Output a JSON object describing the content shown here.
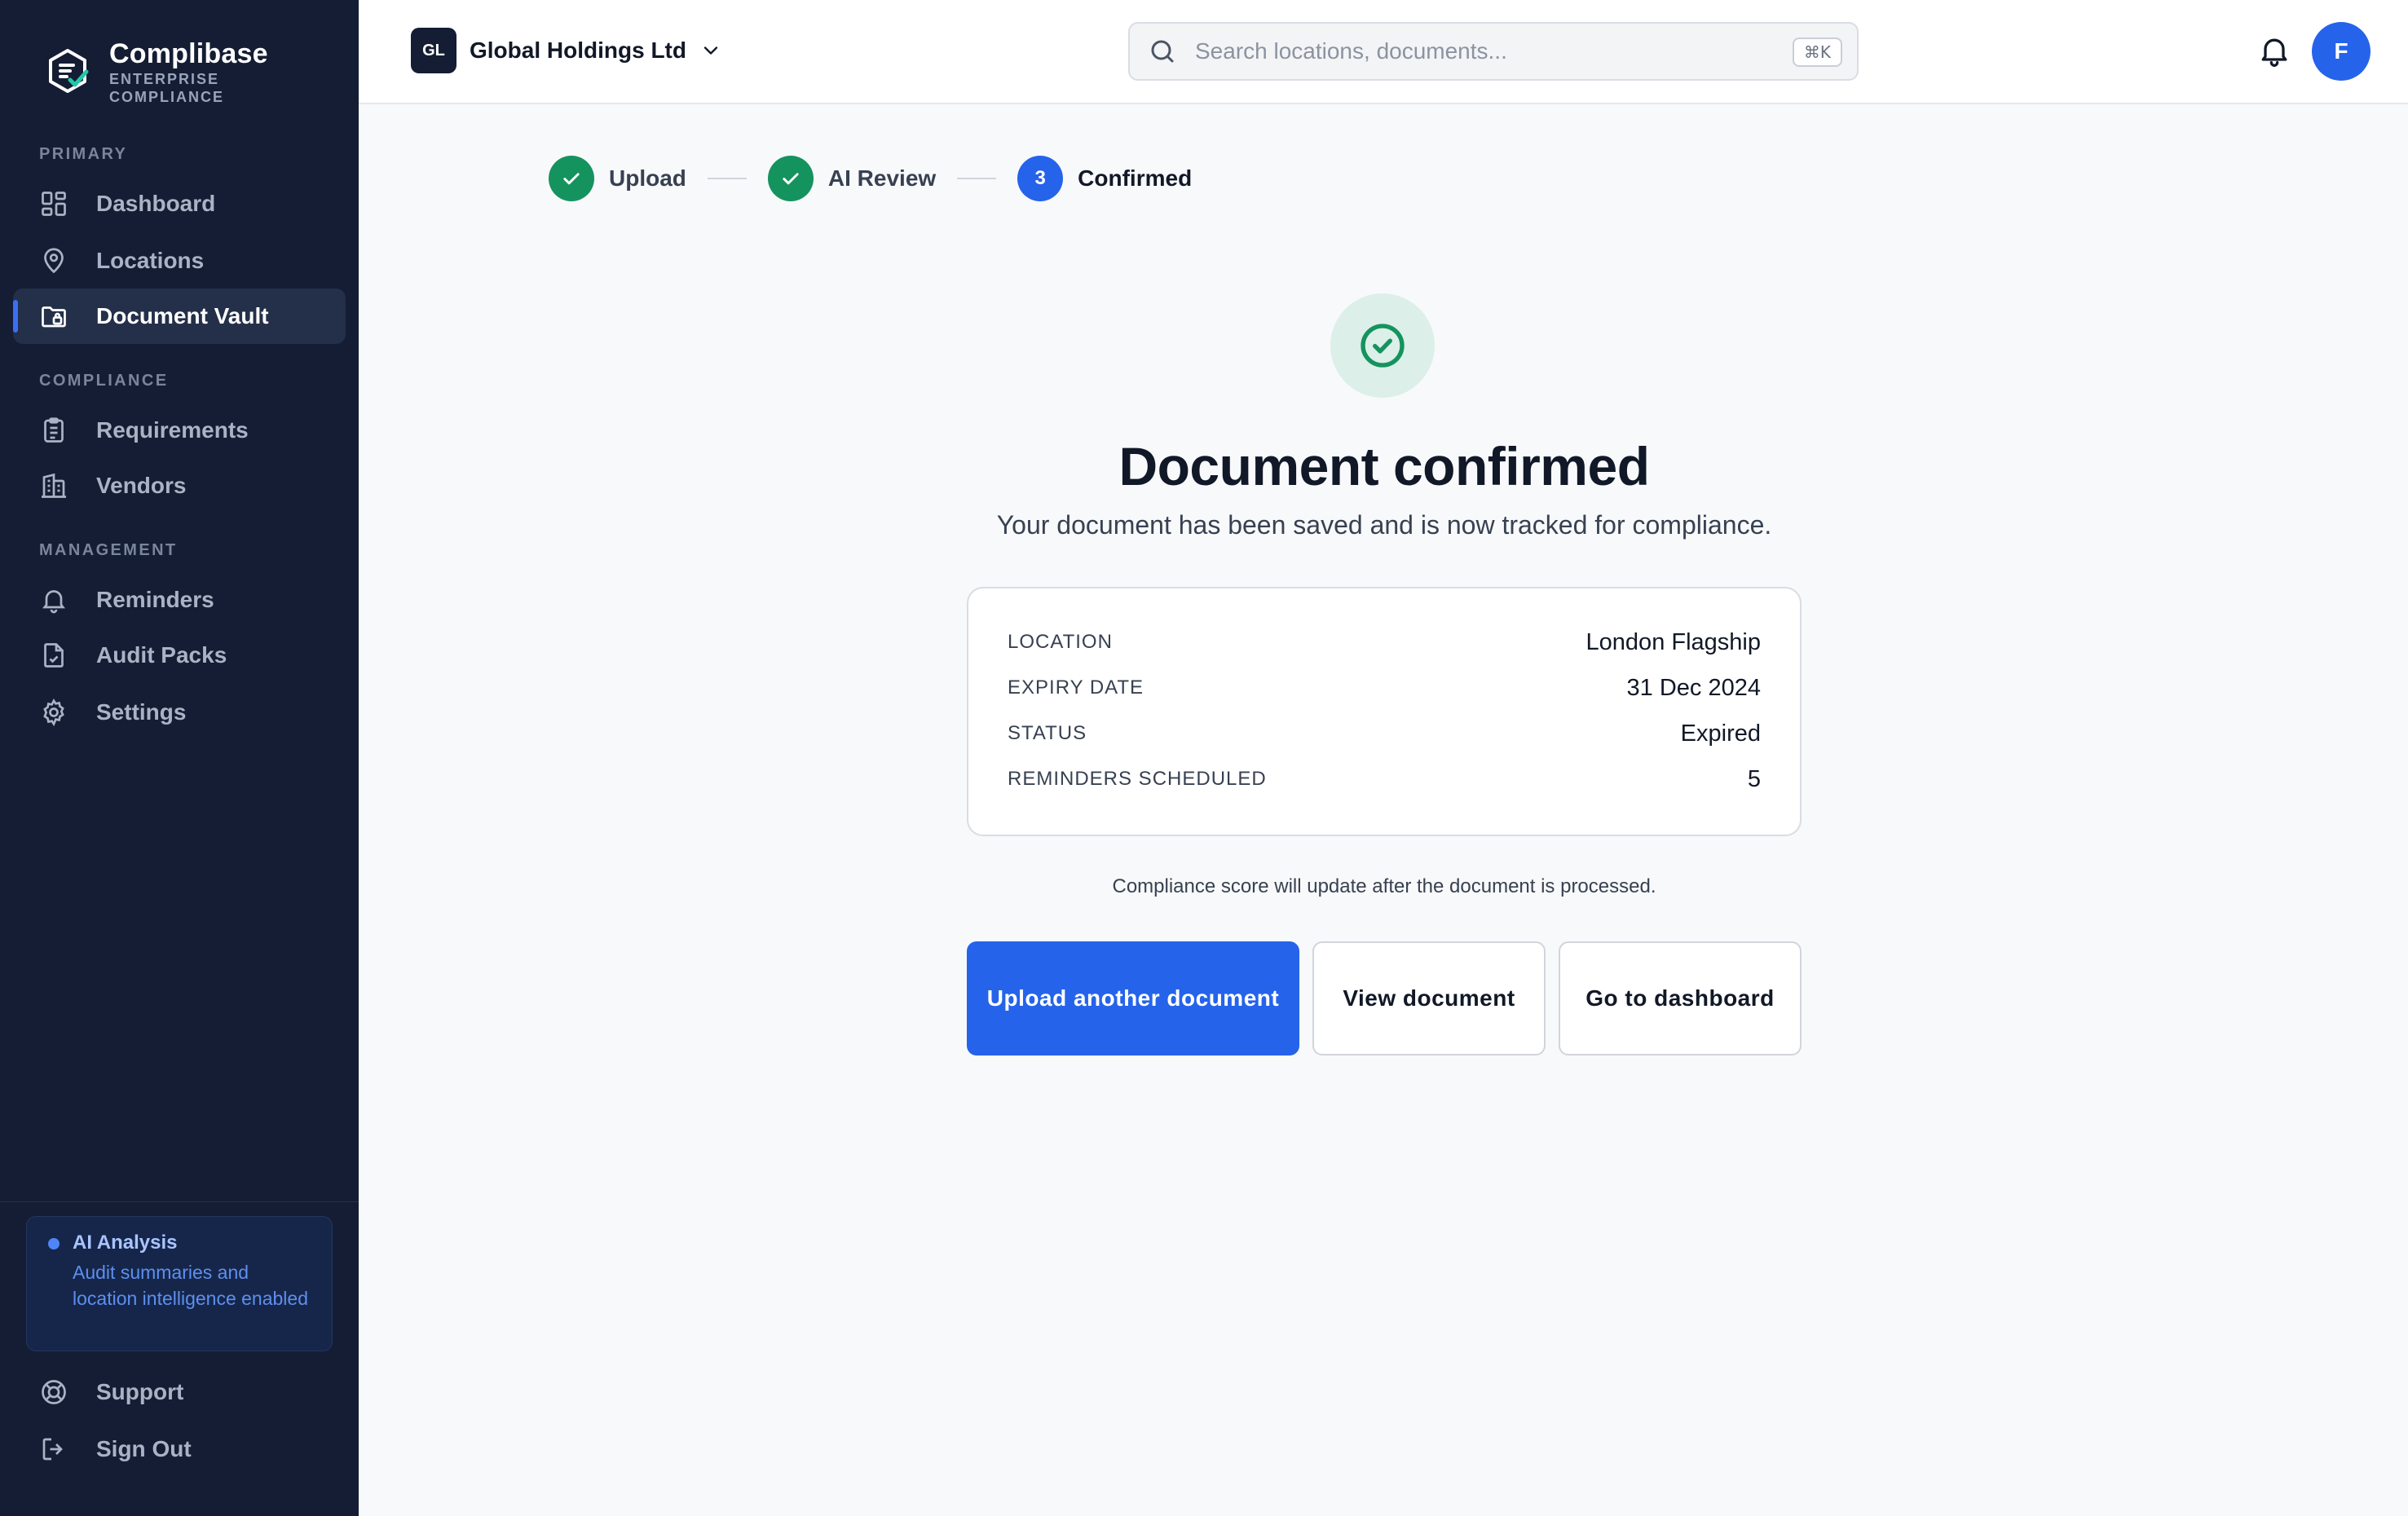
{
  "brand": {
    "name": "Complibase",
    "subtitle_line1": "ENTERPRISE",
    "subtitle_line2": "COMPLIANCE"
  },
  "sidebar": {
    "sections": {
      "primary": "PRIMARY",
      "compliance": "COMPLIANCE",
      "management": "MANAGEMENT"
    },
    "items": {
      "dashboard": "Dashboard",
      "locations": "Locations",
      "document_vault": "Document Vault",
      "requirements": "Requirements",
      "vendors": "Vendors",
      "reminders": "Reminders",
      "audit_packs": "Audit Packs",
      "settings": "Settings",
      "support": "Support",
      "sign_out": "Sign Out"
    },
    "active_item": "Document Vault",
    "ai_card": {
      "title": "AI Analysis",
      "description": "Audit summaries and location intelligence enabled"
    }
  },
  "topbar": {
    "org_initials": "GL",
    "org_name": "Global Holdings Ltd",
    "search_placeholder": "Search locations, documents...",
    "search_shortcut": "⌘K",
    "avatar_initial": "F"
  },
  "stepper": {
    "steps": [
      {
        "label": "Upload",
        "state": "done"
      },
      {
        "label": "AI Review",
        "state": "done"
      },
      {
        "label": "Confirmed",
        "state": "current",
        "number": "3"
      }
    ]
  },
  "confirmation": {
    "title": "Document confirmed",
    "subtitle": "Your document has been saved and is now tracked for compliance.",
    "summary": [
      {
        "key": "LOCATION",
        "value": "London Flagship"
      },
      {
        "key": "EXPIRY DATE",
        "value": "31 Dec 2024"
      },
      {
        "key": "STATUS",
        "value": "Expired"
      },
      {
        "key": "REMINDERS SCHEDULED",
        "value": "5"
      }
    ],
    "note": "Compliance score will update after the document is processed.",
    "buttons": {
      "upload_another": "Upload another document",
      "view_document": "View document",
      "go_to_dashboard": "Go to dashboard"
    }
  },
  "colors": {
    "sidebar_bg": "#141d33",
    "accent": "#2563eb",
    "success": "#15935f"
  }
}
